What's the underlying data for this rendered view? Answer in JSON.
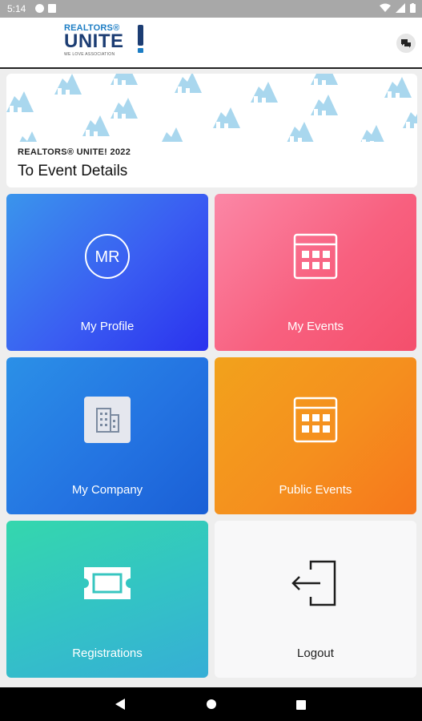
{
  "status_bar": {
    "time": "5:14"
  },
  "header": {
    "logo_top": "REALTORS®",
    "logo_main": "UNITE",
    "logo_sub": "WE LOVE ASSOCIATION"
  },
  "event": {
    "kicker": "REALTORS® UNITE! 2022",
    "title": "To Event Details"
  },
  "tiles": [
    {
      "label": "My Profile",
      "initials": "MR",
      "icon": "profile-initials-icon"
    },
    {
      "label": "My Events",
      "icon": "calendar-icon"
    },
    {
      "label": "My Company",
      "icon": "building-icon"
    },
    {
      "label": "Public Events",
      "icon": "calendar-icon"
    },
    {
      "label": "Registrations",
      "icon": "ticket-icon"
    },
    {
      "label": "Logout",
      "icon": "logout-icon"
    }
  ],
  "colors": {
    "brand_navy": "#1c3d73",
    "brand_blue": "#1c7dc4",
    "pattern_blue": "#a9d7ee"
  }
}
